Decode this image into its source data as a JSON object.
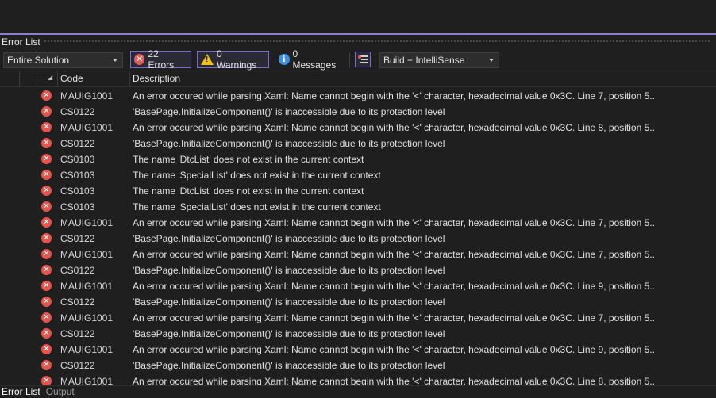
{
  "panel": {
    "title": "Error List"
  },
  "toolbar": {
    "scope_selected": "Entire Solution",
    "errors_label": "22 Errors",
    "warnings_label": "0 Warnings",
    "messages_label": "0 Messages",
    "build_selected": "Build + IntelliSense"
  },
  "columns": {
    "code": "Code",
    "description": "Description"
  },
  "rows": [
    {
      "code": "MAUIG1001",
      "description": "An error occured while parsing Xaml: Name cannot begin with the '<' character, hexadecimal value 0x3C. Line 7, position 5.."
    },
    {
      "code": "CS0122",
      "description": "'BasePage.InitializeComponent()' is inaccessible due to its protection level"
    },
    {
      "code": "MAUIG1001",
      "description": "An error occured while parsing Xaml: Name cannot begin with the '<' character, hexadecimal value 0x3C. Line 8, position 5.."
    },
    {
      "code": "CS0122",
      "description": "'BasePage.InitializeComponent()' is inaccessible due to its protection level"
    },
    {
      "code": "CS0103",
      "description": "The name 'DtcList' does not exist in the current context"
    },
    {
      "code": "CS0103",
      "description": "The name 'SpecialList' does not exist in the current context"
    },
    {
      "code": "CS0103",
      "description": "The name 'DtcList' does not exist in the current context"
    },
    {
      "code": "CS0103",
      "description": "The name 'SpecialList' does not exist in the current context"
    },
    {
      "code": "MAUIG1001",
      "description": "An error occured while parsing Xaml: Name cannot begin with the '<' character, hexadecimal value 0x3C. Line 7, position 5.."
    },
    {
      "code": "CS0122",
      "description": "'BasePage.InitializeComponent()' is inaccessible due to its protection level"
    },
    {
      "code": "MAUIG1001",
      "description": "An error occured while parsing Xaml: Name cannot begin with the '<' character, hexadecimal value 0x3C. Line 7, position 5.."
    },
    {
      "code": "CS0122",
      "description": "'BasePage.InitializeComponent()' is inaccessible due to its protection level"
    },
    {
      "code": "MAUIG1001",
      "description": "An error occured while parsing Xaml: Name cannot begin with the '<' character, hexadecimal value 0x3C. Line 9, position 5.."
    },
    {
      "code": "CS0122",
      "description": "'BasePage.InitializeComponent()' is inaccessible due to its protection level"
    },
    {
      "code": "MAUIG1001",
      "description": "An error occured while parsing Xaml: Name cannot begin with the '<' character, hexadecimal value 0x3C. Line 7, position 5.."
    },
    {
      "code": "CS0122",
      "description": "'BasePage.InitializeComponent()' is inaccessible due to its protection level"
    },
    {
      "code": "MAUIG1001",
      "description": "An error occured while parsing Xaml: Name cannot begin with the '<' character, hexadecimal value 0x3C. Line 9, position 5.."
    },
    {
      "code": "CS0122",
      "description": "'BasePage.InitializeComponent()' is inaccessible due to its protection level"
    },
    {
      "code": "MAUIG1001",
      "description": "An error occured while parsing Xaml: Name cannot begin with the '<' character, hexadecimal value 0x3C. Line 8, position 5.."
    }
  ],
  "bottom_tabs": [
    {
      "label": "Error List",
      "active": true
    },
    {
      "label": "Output",
      "active": false
    }
  ],
  "icons": {
    "error": "error-icon",
    "warning": "warning-icon",
    "info": "info-icon",
    "filter": "filter-icon"
  },
  "colors": {
    "accent": "#8b7cdb",
    "error": "#e5534b",
    "warning": "#f0c11a",
    "info": "#3d8fe0"
  }
}
